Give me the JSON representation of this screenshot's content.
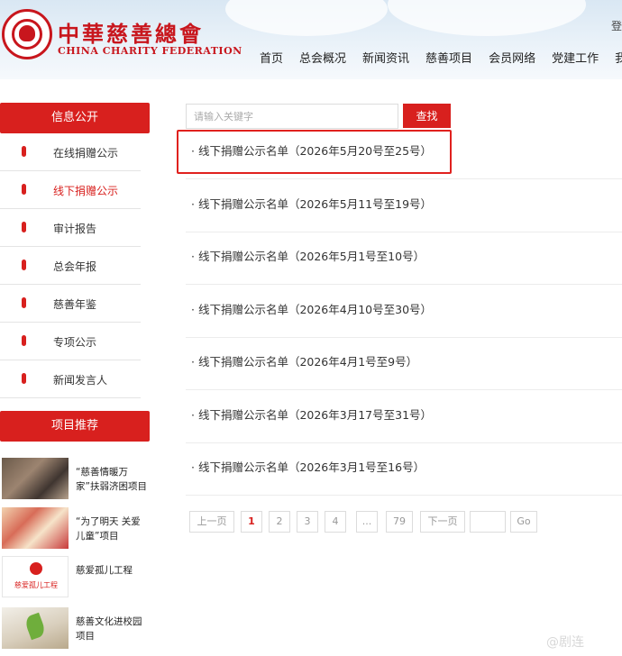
{
  "header": {
    "logo_cn": "中華慈善總會",
    "logo_en": "CHINA CHARITY FEDERATION",
    "login": "登",
    "nav": [
      "首页",
      "总会概况",
      "新闻资讯",
      "慈善项目",
      "会员网络",
      "党建工作",
      "我"
    ]
  },
  "sidebar": {
    "section_title": "信息公开",
    "items": [
      {
        "label": "在线捐赠公示",
        "active": false
      },
      {
        "label": "线下捐赠公示",
        "active": true
      },
      {
        "label": "审计报告",
        "active": false
      },
      {
        "label": "总会年报",
        "active": false
      },
      {
        "label": "慈善年鉴",
        "active": false
      },
      {
        "label": "专项公示",
        "active": false
      },
      {
        "label": "新闻发言人",
        "active": false
      }
    ],
    "projects_title": "项目推荐",
    "projects": [
      {
        "text": "“慈善情暖万家”扶弱济困项目"
      },
      {
        "text": "“为了明天 关爱儿童”项目"
      },
      {
        "text": "慈爱孤儿工程",
        "thumb_caption": "慈爱孤儿工程"
      },
      {
        "text": "慈善文化进校园项目"
      }
    ]
  },
  "search": {
    "placeholder": "请输入关键字",
    "button": "查找"
  },
  "list": [
    "· 线下捐赠公示名单（2026年5月20号至25号）",
    "· 线下捐赠公示名单（2026年5月11号至19号）",
    "· 线下捐赠公示名单（2026年5月1号至10号）",
    "· 线下捐赠公示名单（2026年4月10号至30号）",
    "· 线下捐赠公示名单（2026年4月1号至9号）",
    "· 线下捐赠公示名单（2026年3月17号至31号）",
    "· 线下捐赠公示名单（2026年3月1号至16号）"
  ],
  "pager": {
    "prev": "上一页",
    "pages": [
      "1",
      "2",
      "3",
      "4",
      "...",
      "79"
    ],
    "current": "1",
    "next": "下一页",
    "go": "Go"
  },
  "watermark": "@剧连",
  "colors": {
    "accent": "#d8201e",
    "highlight": "#e0211e"
  }
}
